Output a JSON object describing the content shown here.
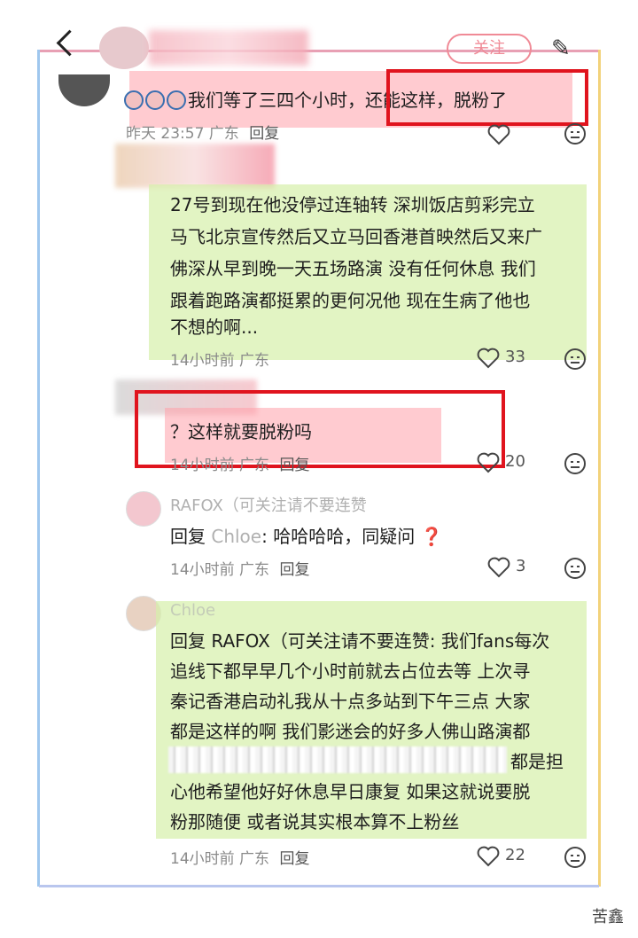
{
  "header": {
    "follow_label": "关注"
  },
  "comments": [
    {
      "text": "我们等了三四个小时，还能这样，脱粉了",
      "time": "昨天 23:57 广东",
      "reply": "回复"
    },
    {
      "lines": [
        "27号到现在他没停过连轴转 深圳饭店剪彩完立",
        "马飞北京宣传然后又立马回香港首映然后又来广",
        "佛深从早到晚一天五场路演 没有任何休息 我们",
        "跟着跑路演都挺累的更何况他 现在生病了他也",
        "不想的啊..."
      ],
      "time": "14小时前 广东",
      "likes": "33"
    },
    {
      "text": "？这样就要脱粉吗",
      "time": "14小时前 广东",
      "reply": "回复",
      "likes": "20"
    },
    {
      "username": "RAFOX（可关注请不要连赞",
      "text_prefix": "回复 ",
      "reply_to": "Chloe",
      "text": ": 哈哈哈哈，同疑问",
      "emoji": "❓",
      "time": "14小时前 广东",
      "reply": "回复",
      "likes": "3"
    },
    {
      "username": "Chloe",
      "lines": [
        "回复 RAFOX（可关注请不要连赞: 我们fans每次",
        "追线下都早早几个小时前就去占位去等 上次寻",
        "秦记香港启动礼我从十点多站到下午三点 大家",
        "都是这样的啊 我们影迷会的好多人佛山路演都",
        "都是担",
        "心他希望他好好休息早日康复 如果这就说要脱",
        "粉那随便 或者说其实根本算不上粉丝"
      ],
      "time": "14小时前 广东",
      "reply": "回复",
      "likes": "22"
    }
  ],
  "watermark": "苦鑫",
  "colors": {
    "highlight_pink": "#ffa0aa",
    "highlight_green": "#d6f0aa",
    "red_box": "#e0141e"
  }
}
